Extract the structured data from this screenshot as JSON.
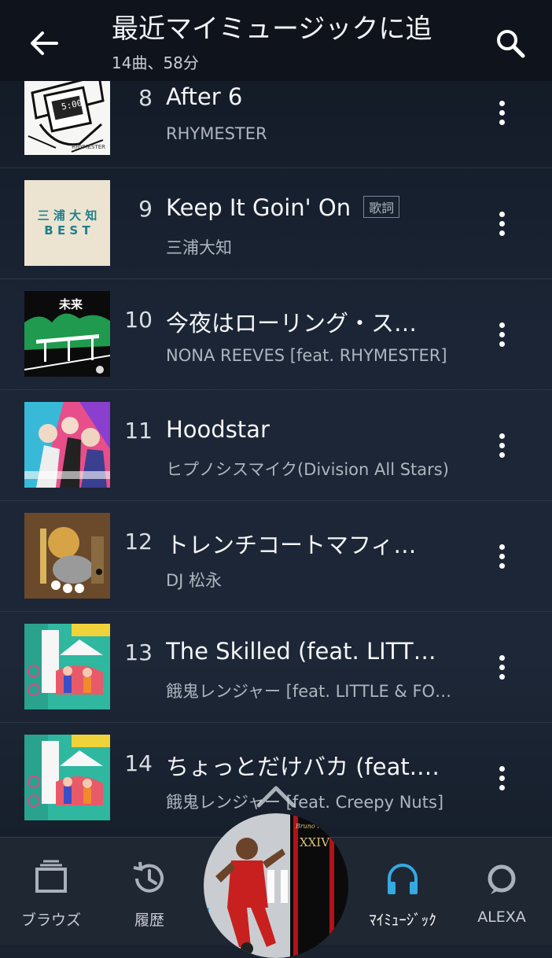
{
  "header": {
    "back_icon": "arrow-left-icon",
    "title": "最近マイミュージックに追",
    "subtitle": "14曲、58分",
    "search_icon": "search-icon"
  },
  "tracks": [
    {
      "num": "8",
      "title": "After 6",
      "artist": "RHYMESTER",
      "badge": ""
    },
    {
      "num": "9",
      "title": "Keep It Goin' On",
      "artist": "三浦大知",
      "badge": "歌詞"
    },
    {
      "num": "10",
      "title": "今夜はローリング・ス…",
      "artist": "NONA REEVES [feat. RHYMESTER]",
      "badge": ""
    },
    {
      "num": "11",
      "title": "Hoodstar",
      "artist": "ヒプノシスマイク(Division All Stars)",
      "badge": ""
    },
    {
      "num": "12",
      "title": "トレンチコートマフィ…",
      "artist": "DJ 松永",
      "badge": ""
    },
    {
      "num": "13",
      "title": "The Skilled (feat. LITTLE…",
      "artist": "餓鬼レンジャー [feat. LITTLE & FO…",
      "badge": ""
    },
    {
      "num": "14",
      "title": "ちょっとだけバカ (feat.…",
      "artist": "餓鬼レンジャー [feat. Creepy Nuts]",
      "badge": ""
    }
  ],
  "art": {
    "8": {
      "text": "5:00",
      "brand": "RHYMESTER"
    },
    "9": {
      "line1": "三 浦 大 知",
      "line2": "B E S T"
    },
    "10": {
      "text": "未来"
    }
  },
  "nav": {
    "browse": "ブラウズ",
    "history": "履歴",
    "mymusic": "ﾏｲﾐｭｰｼﾞｯｸ",
    "alexa": "ALEXA"
  },
  "player": {
    "album_text": "XXIV",
    "album_sub": "Bruno Mars"
  },
  "colors": {
    "accent": "#35a9e0",
    "text_primary": "#f5f6f8",
    "text_secondary": "#aeb5bf",
    "background": "#1b2535"
  }
}
